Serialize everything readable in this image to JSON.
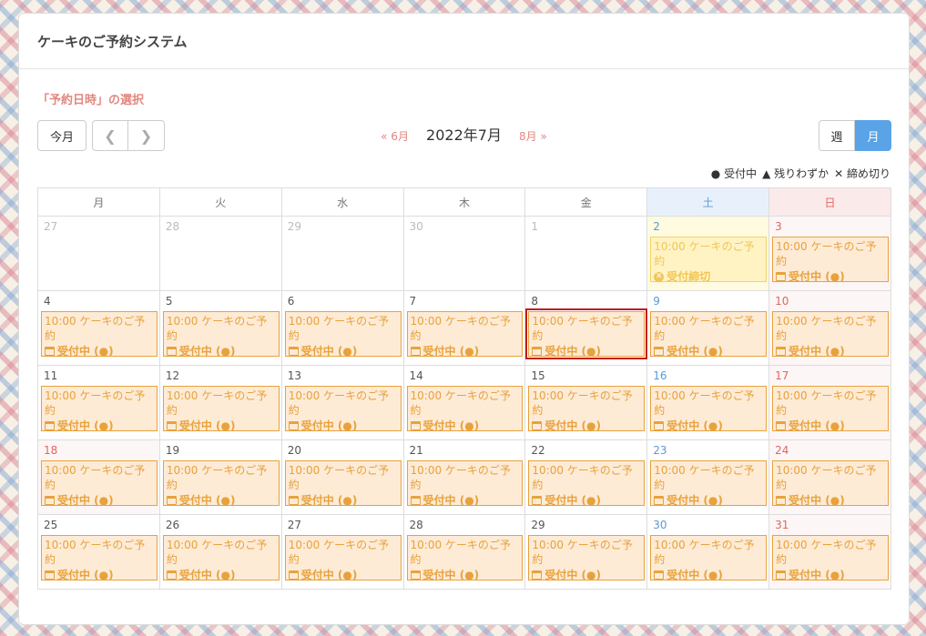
{
  "header": {
    "title": "ケーキのご予約システム"
  },
  "section_label": "「予約日時」の選択",
  "toolbar": {
    "today_label": "今月",
    "prev_icon": "chevron-left",
    "next_icon": "chevron-right",
    "prev_month_label": "« 6月",
    "current_month": "2022年7月",
    "next_month_label": "8月 »",
    "week_label": "週",
    "month_label": "月"
  },
  "legend": {
    "open": "● 受付中",
    "few": "▲ 残りわずか",
    "closed": "✕ 締め切り"
  },
  "weekdays": [
    "月",
    "火",
    "水",
    "木",
    "金",
    "土",
    "日"
  ],
  "colors": {
    "accent": "#5aa3e6",
    "event_border": "#e8a23c",
    "event_bg": "#fdebd6",
    "selected": "#c21c1c"
  },
  "event_title": "10:00 ケーキのご予約",
  "open_status": "受付中 (●)",
  "closed_status": "受付締切",
  "weeks": [
    [
      {
        "d": "27",
        "out": true
      },
      {
        "d": "28",
        "out": true
      },
      {
        "d": "29",
        "out": true
      },
      {
        "d": "30",
        "out": true
      },
      {
        "d": "1",
        "out": true
      },
      {
        "d": "2",
        "type": "sat",
        "status": "closed"
      },
      {
        "d": "3",
        "type": "sun",
        "status": "open"
      }
    ],
    [
      {
        "d": "4",
        "status": "open"
      },
      {
        "d": "5",
        "status": "open"
      },
      {
        "d": "6",
        "status": "open"
      },
      {
        "d": "7",
        "status": "open"
      },
      {
        "d": "8",
        "status": "open",
        "selected": true
      },
      {
        "d": "9",
        "type": "sat",
        "status": "open"
      },
      {
        "d": "10",
        "type": "sun",
        "status": "open"
      }
    ],
    [
      {
        "d": "11",
        "status": "open"
      },
      {
        "d": "12",
        "status": "open"
      },
      {
        "d": "13",
        "status": "open"
      },
      {
        "d": "14",
        "status": "open"
      },
      {
        "d": "15",
        "status": "open"
      },
      {
        "d": "16",
        "type": "sat",
        "status": "open"
      },
      {
        "d": "17",
        "type": "sun",
        "status": "open"
      }
    ],
    [
      {
        "d": "18",
        "type": "sun",
        "status": "open"
      },
      {
        "d": "19",
        "status": "open"
      },
      {
        "d": "20",
        "status": "open"
      },
      {
        "d": "21",
        "status": "open"
      },
      {
        "d": "22",
        "status": "open"
      },
      {
        "d": "23",
        "type": "sat",
        "status": "open"
      },
      {
        "d": "24",
        "type": "sun",
        "status": "open"
      }
    ],
    [
      {
        "d": "25",
        "status": "open"
      },
      {
        "d": "26",
        "status": "open"
      },
      {
        "d": "27",
        "status": "open"
      },
      {
        "d": "28",
        "status": "open"
      },
      {
        "d": "29",
        "status": "open"
      },
      {
        "d": "30",
        "type": "sat",
        "status": "open"
      },
      {
        "d": "31",
        "type": "sun",
        "status": "open"
      }
    ]
  ]
}
